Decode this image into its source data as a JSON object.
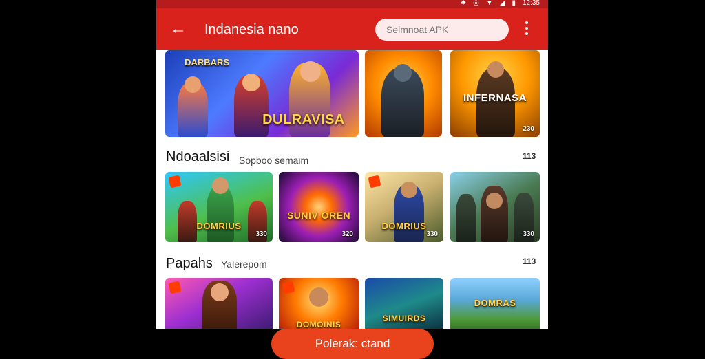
{
  "status": {
    "time": "12:35"
  },
  "header": {
    "back_icon": "arrow-left-icon",
    "title": "Indanesia nano",
    "search_placeholder": "Selmnoat APK",
    "menu_icon": "more-vert-icon"
  },
  "featured": [
    {
      "title": "DULRAVISA",
      "top": "DARBARS",
      "badge": ""
    },
    {
      "title": "",
      "top": "",
      "badge": ""
    },
    {
      "title": "INFERNASA",
      "top": "",
      "badge": "230"
    }
  ],
  "sections": [
    {
      "title": "Ndoaalsisi",
      "subtitle": "Sopboo semaim",
      "more": "113",
      "items": [
        {
          "title": "DOMRIUS",
          "count": "330"
        },
        {
          "title": "SUNIV OREN",
          "count": "320"
        },
        {
          "title": "DOMRIUS",
          "count": "330"
        },
        {
          "title": "",
          "count": "330"
        }
      ]
    },
    {
      "title": "Papahs",
      "subtitle": "Yalerepom",
      "more": "113",
      "items": [
        {
          "title": "",
          "count": ""
        },
        {
          "title": "DOMOINIS",
          "count": ""
        },
        {
          "title": "SIMUIRDS",
          "count": ""
        },
        {
          "title": "DOMRAS",
          "count": ""
        }
      ]
    }
  ],
  "cta": {
    "label": "Polerak: ctand"
  },
  "colors": {
    "appbar": "#d9221b",
    "cta": "#e8431c"
  }
}
